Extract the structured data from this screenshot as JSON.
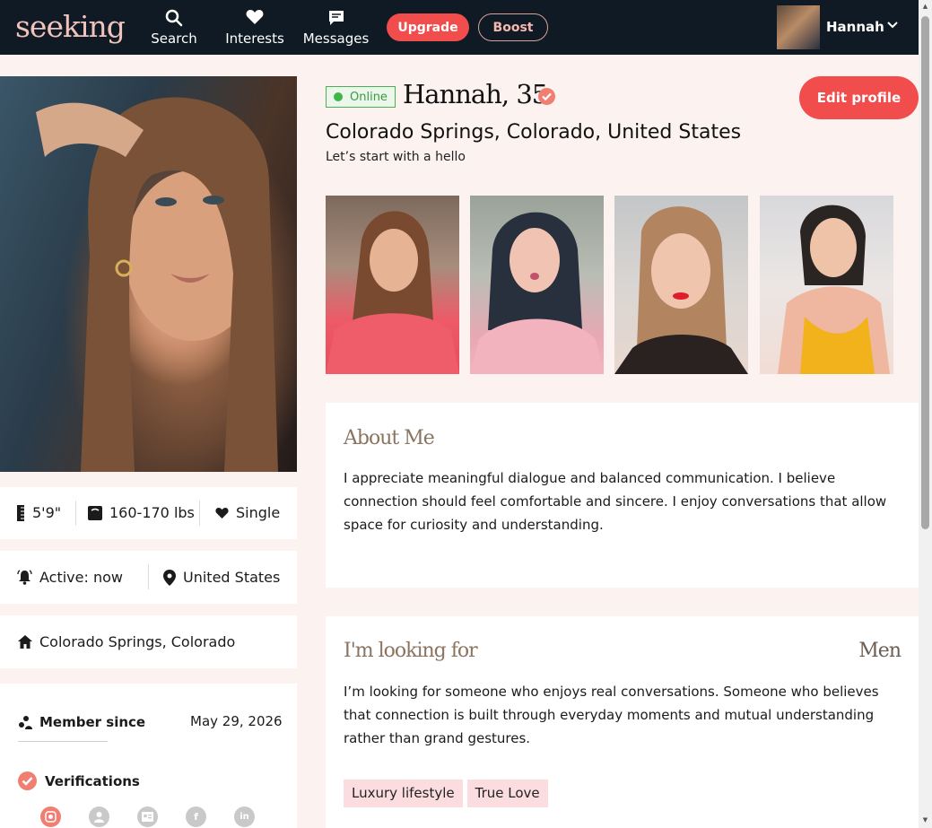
{
  "nav": {
    "logo": "seeking",
    "items": [
      {
        "label": "Search",
        "icon": "search-icon"
      },
      {
        "label": "Interests",
        "icon": "heart-icon"
      },
      {
        "label": "Messages",
        "icon": "chat-icon"
      }
    ],
    "upgrade_label": "Upgrade",
    "boost_label": "Boost",
    "user_name": "Hannah"
  },
  "profile": {
    "online_label": "Online",
    "name_age": "Hannah, 35",
    "edit_label": "Edit profile",
    "location": "Colorado Springs, Colorado, United States",
    "tagline": "Let’s start with a hello"
  },
  "stats": {
    "height": "5'9\"",
    "weight": "160-170 lbs",
    "relationship": "Single",
    "active": "Active: now",
    "country": "United States",
    "city": "Colorado Springs, Colorado",
    "member_since_label": "Member since",
    "member_since_date": "May 29, 2026",
    "verifications_label": "Verifications",
    "verification_icons": [
      "photo-verified-icon",
      "profile-verified-icon",
      "id-verified-icon",
      "facebook-icon",
      "linkedin-icon"
    ]
  },
  "about": {
    "title": "About Me",
    "text": "I appreciate meaningful dialogue and balanced communication. I believe connection should feel comfortable and sincere. I enjoy conversations that allow space for curiosity and understanding."
  },
  "looking_for": {
    "title": "I'm looking for",
    "seeking": "Men",
    "text": "I’m looking for someone who enjoys real conversations. Someone who believes that connection is built through everyday moments and mutual understanding rather than grand gestures.",
    "tags": [
      "Luxury lifestyle",
      "True Love"
    ]
  },
  "colors": {
    "accent": "#f14d4d",
    "nav_bg": "#0f1a24",
    "page_bg": "#fcf3f1",
    "section_title": "#8a7460",
    "online_green": "#3fb54a",
    "tag_bg": "#fbdcdf"
  }
}
